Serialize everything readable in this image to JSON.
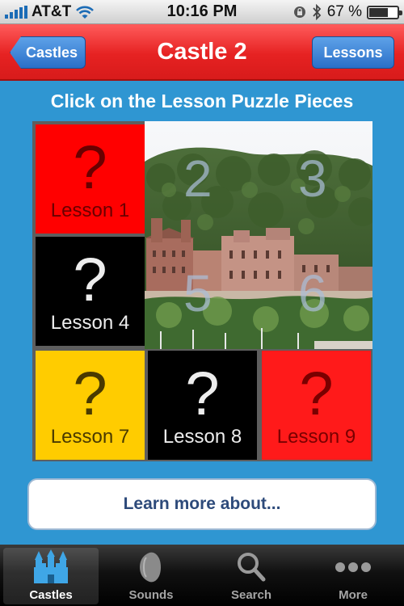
{
  "status_bar": {
    "carrier": "AT&T",
    "time": "10:16 PM",
    "battery_percent_label": "67 %",
    "battery_level": 0.67
  },
  "nav": {
    "title": "Castle 2",
    "back_label": "Castles",
    "right_label": "Lessons",
    "accent_color": "#e62222",
    "button_color": "#2a6fc8"
  },
  "instruction": "Click on the Lesson Puzzle Pieces",
  "puzzle": {
    "tiles": [
      {
        "symbol": "?",
        "label": "Lesson 1",
        "color": "#ff0000"
      },
      {
        "symbol": "?",
        "label": "Lesson 4",
        "color": "#000000"
      },
      {
        "symbol": "?",
        "label": "Lesson 7",
        "color": "#ffcc00"
      },
      {
        "symbol": "?",
        "label": "Lesson 8",
        "color": "#000000"
      },
      {
        "symbol": "?",
        "label": "Lesson 9",
        "color": "#ff1a1a"
      }
    ],
    "photo_numbers": [
      "2",
      "3",
      "5",
      "6"
    ]
  },
  "learn_more": "Learn more about...",
  "tabs": [
    {
      "label": "Castles",
      "icon": "castle-icon",
      "active": true
    },
    {
      "label": "Sounds",
      "icon": "speaker-icon",
      "active": false
    },
    {
      "label": "Search",
      "icon": "search-icon",
      "active": false
    },
    {
      "label": "More",
      "icon": "more-dots-icon",
      "active": false
    }
  ]
}
